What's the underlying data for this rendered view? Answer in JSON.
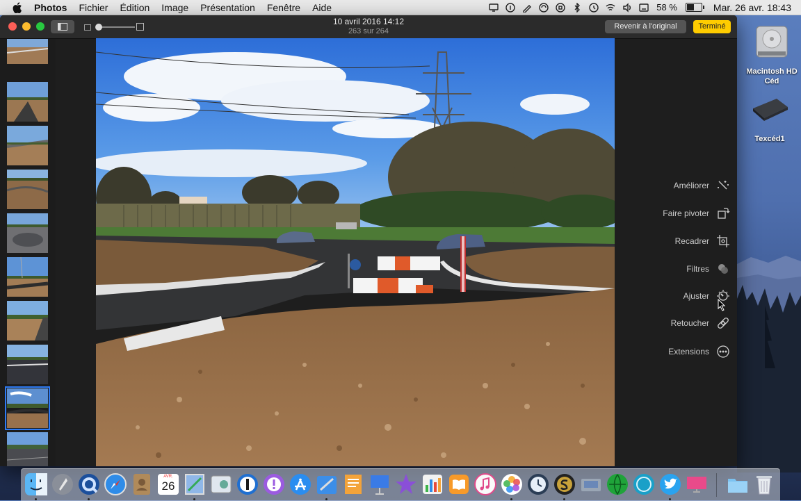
{
  "menubar": {
    "app_name": "Photos",
    "menus": [
      "Fichier",
      "Édition",
      "Image",
      "Présentation",
      "Fenêtre",
      "Aide"
    ],
    "battery_percent": "58 %",
    "battery_level": 0.58,
    "clock": "Mar. 26 avr.  18:43",
    "status_icons": [
      "display-icon",
      "onepassword-icon",
      "pen-icon",
      "sync-icon",
      "stop-icon",
      "bluetooth-icon",
      "time-machine-icon",
      "wifi-icon",
      "volume-icon",
      "keyboard-icon"
    ]
  },
  "window": {
    "title_date": "10 avril 2016 14:12",
    "title_count": "263 sur 264",
    "revert_label": "Revenir à l'original",
    "done_label": "Terminé"
  },
  "filmstrip": {
    "selected_index": 7,
    "thumbnails": [
      "thumb-1",
      "thumb-2",
      "thumb-3",
      "thumb-4",
      "thumb-5",
      "thumb-6",
      "thumb-7",
      "thumb-8",
      "thumb-9",
      "thumb-10"
    ]
  },
  "tools": [
    {
      "label": "Améliorer",
      "icon": "magic-wand-icon"
    },
    {
      "label": "Faire pivoter",
      "icon": "rotate-icon"
    },
    {
      "label": "Recadrer",
      "icon": "crop-icon"
    },
    {
      "label": "Filtres",
      "icon": "filters-icon"
    },
    {
      "label": "Ajuster",
      "icon": "adjust-icon"
    },
    {
      "label": "Retoucher",
      "icon": "bandage-icon"
    },
    {
      "label": "Extensions",
      "icon": "extensions-icon"
    }
  ],
  "desktop": {
    "items": [
      {
        "label": "Macintosh HD Céd",
        "icon": "hard-drive-icon"
      },
      {
        "label": "Texcéd1",
        "icon": "external-drive-icon"
      }
    ]
  },
  "dock": {
    "calendar_day": "26",
    "calendar_month": "AVR.",
    "apps": [
      "finder",
      "launchpad",
      "quicktime",
      "safari",
      "contacts",
      "calendar",
      "preview",
      "photo-booth",
      "1password",
      "reminders",
      "app-store",
      "xcode",
      "pages",
      "keynote",
      "imovie",
      "numbers",
      "ibooks",
      "itunes",
      "photos",
      "time-machine",
      "scrivener",
      "image-capture",
      "green-app",
      "teal-app",
      "twitter",
      "pink-app",
      "folder",
      "trash"
    ]
  },
  "colors": {
    "accent_done": "#ffcc00",
    "selection": "#2e7bf4"
  }
}
